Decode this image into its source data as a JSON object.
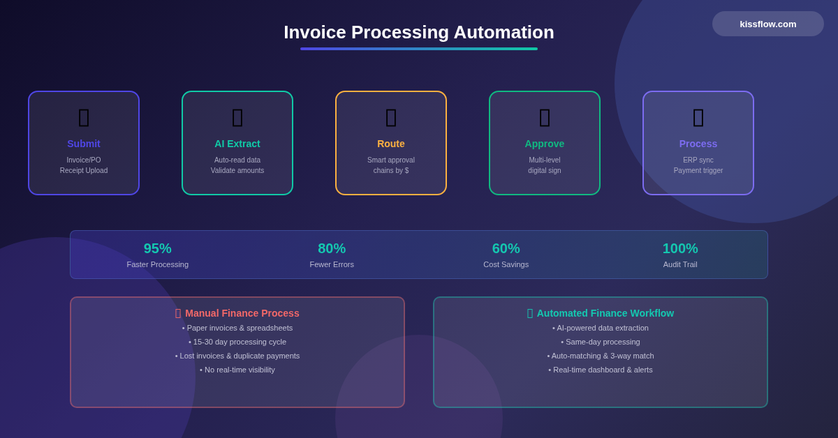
{
  "title": "Invoice Processing Automation",
  "badge": "kissflow.com",
  "steps": [
    {
      "title": "Submit",
      "lines": [
        "Invoice/PO",
        "Receipt Upload"
      ],
      "color": "#4f46e5"
    },
    {
      "title": "AI Extract",
      "lines": [
        "Auto-read data",
        "Validate amounts"
      ],
      "color": "#10c9a6"
    },
    {
      "title": "Route",
      "lines": [
        "Smart approval",
        "chains by $"
      ],
      "color": "#fbb040"
    },
    {
      "title": "Approve",
      "lines": [
        "Multi-level",
        "digital sign"
      ],
      "color": "#10b981"
    },
    {
      "title": "Process",
      "lines": [
        "ERP sync",
        "Payment trigger"
      ],
      "color": "#7c6cf0"
    }
  ],
  "stats": [
    {
      "value": "95%",
      "label": "Faster Processing"
    },
    {
      "value": "80%",
      "label": "Fewer Errors"
    },
    {
      "value": "60%",
      "label": "Cost Savings"
    },
    {
      "value": "100%",
      "label": "Audit Trail"
    }
  ],
  "comparison": [
    {
      "title": "Manual Finance Process",
      "color": "#f26868",
      "items": [
        "• Paper invoices & spreadsheets",
        "• 15-30 day processing cycle",
        "• Lost invoices & duplicate payments",
        "• No real-time visibility"
      ]
    },
    {
      "title": "Automated Finance Workflow",
      "color": "#14c8b0",
      "items": [
        "• AI-powered data extraction",
        "• Same-day processing",
        "• Auto-matching & 3-way match",
        "• Real-time dashboard & alerts"
      ]
    }
  ]
}
